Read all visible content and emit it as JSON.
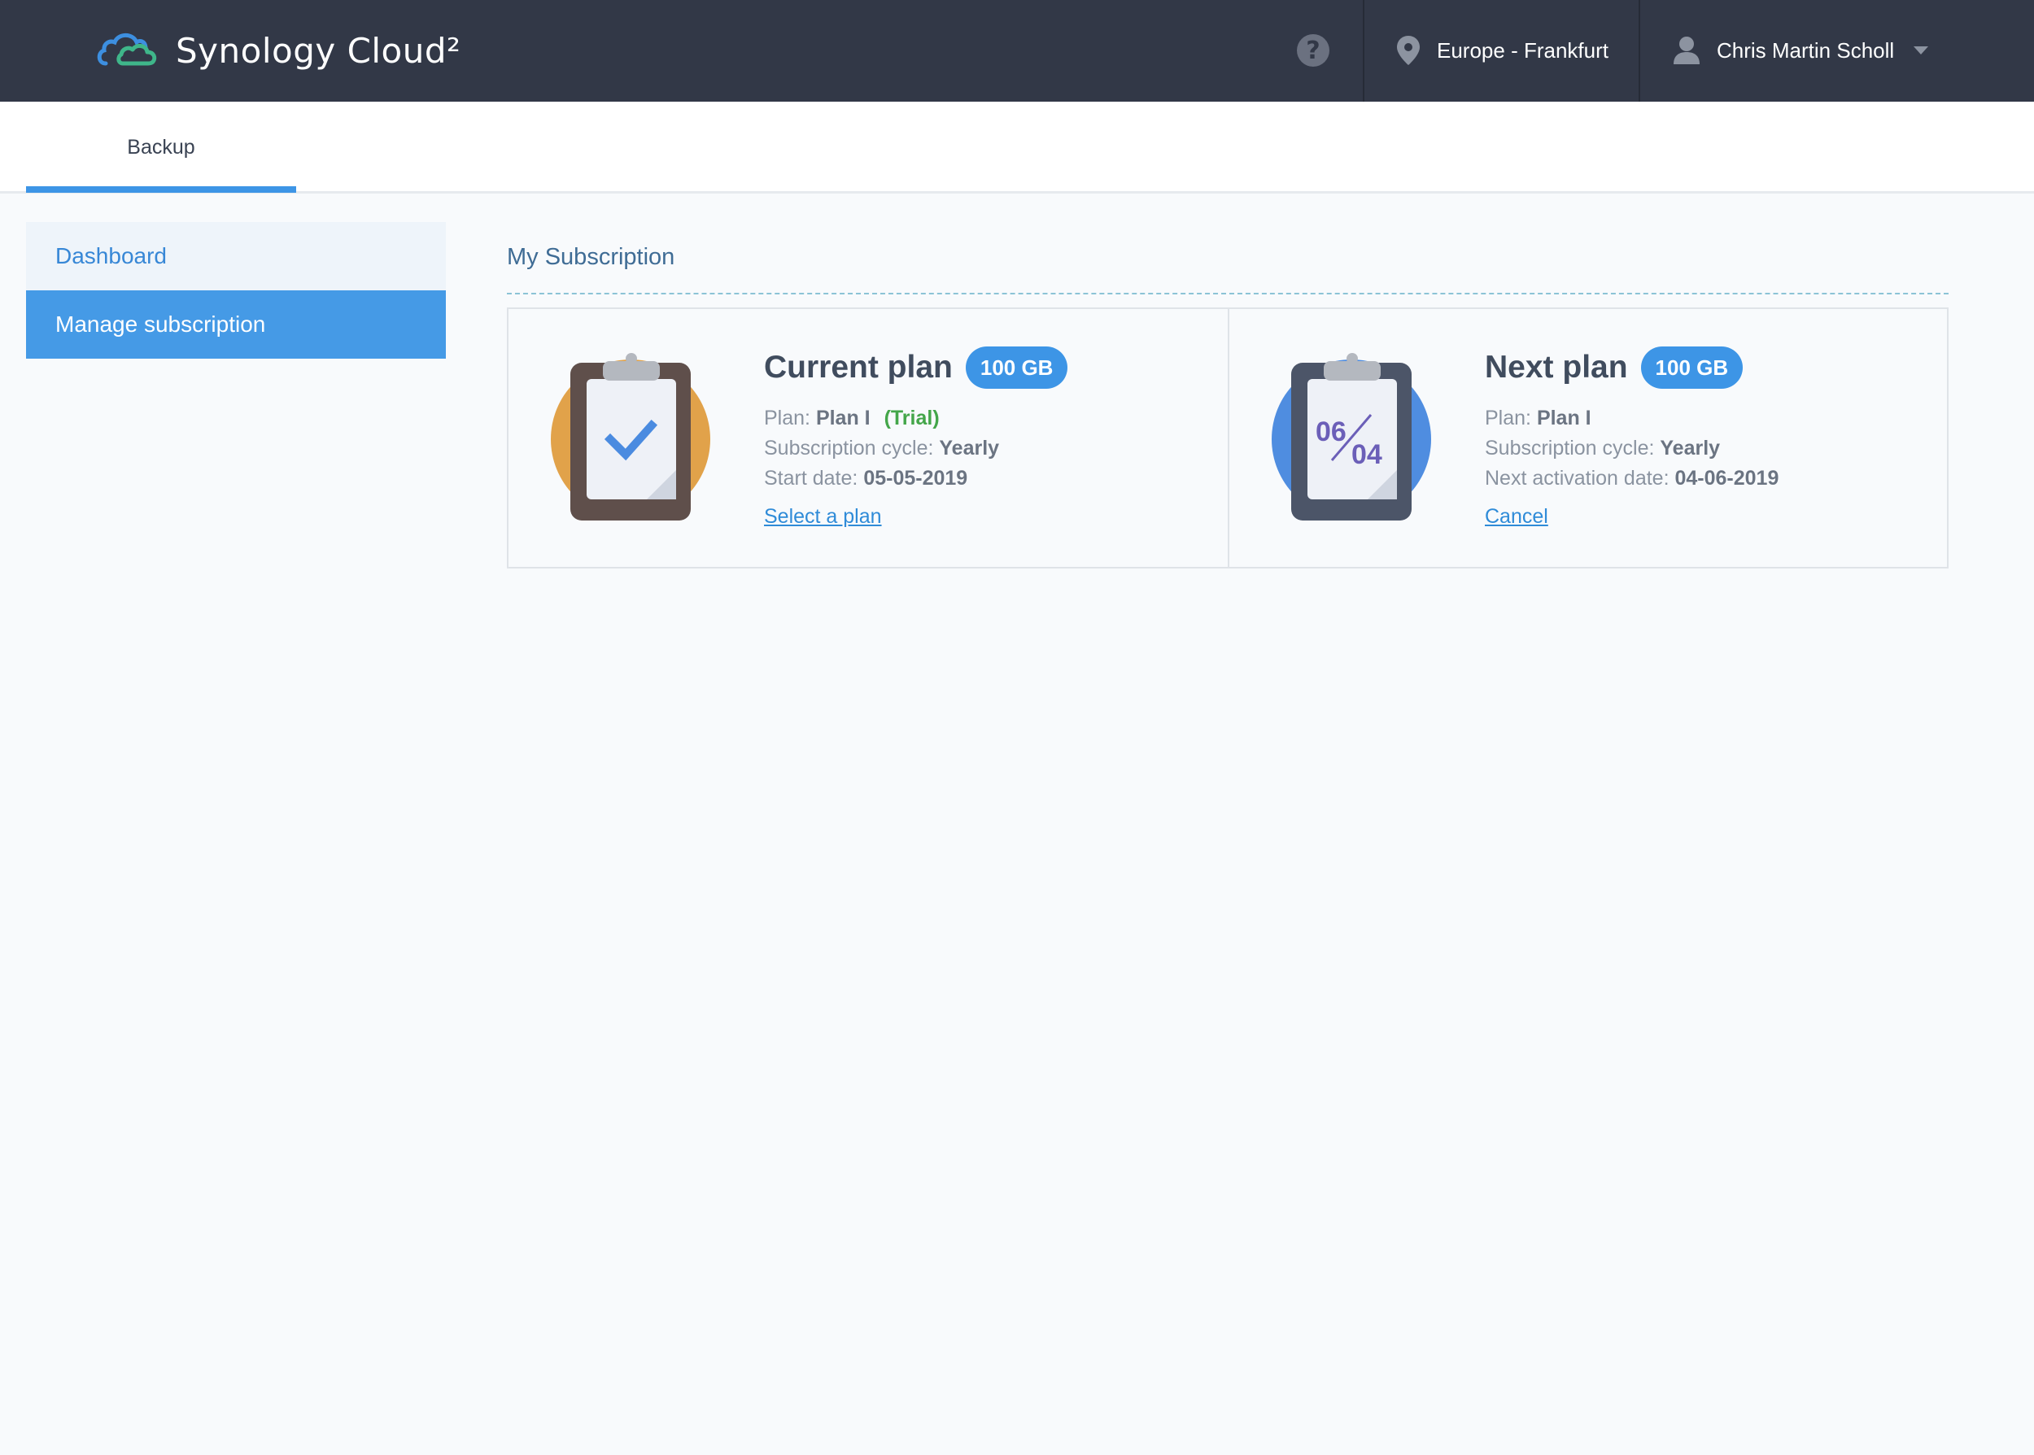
{
  "header": {
    "brand": "Synology Cloud²",
    "help_icon": "question-circle-icon",
    "region": "Europe - Frankfurt",
    "user": "Chris Martin Scholl",
    "colors": {
      "bar": "#323847",
      "accent": "#3d95e6"
    }
  },
  "tabs": [
    {
      "label": "Backup",
      "active": true
    }
  ],
  "sidebar": {
    "items": [
      {
        "label": "Dashboard",
        "active": false
      },
      {
        "label": "Manage subscription",
        "active": true
      }
    ]
  },
  "main": {
    "title": "My Subscription",
    "current_plan": {
      "title": "Current plan",
      "badge": "100 GB",
      "plan_label": "Plan:",
      "plan_value": "Plan I",
      "plan_status": "(Trial)",
      "cycle_label": "Subscription cycle:",
      "cycle_value": "Yearly",
      "date_label": "Start date:",
      "date_value": "05-05-2019",
      "link": "Select a plan",
      "icon": "clipboard-check-icon",
      "icon_color": "#e1a24a"
    },
    "next_plan": {
      "title": "Next plan",
      "badge": "100 GB",
      "plan_label": "Plan:",
      "plan_value": "Plan I",
      "cycle_label": "Subscription cycle:",
      "cycle_value": "Yearly",
      "date_label": "Next activation date:",
      "date_value": "04-06-2019",
      "link": "Cancel",
      "icon": "clipboard-date-icon",
      "icon_color": "#4f8de0",
      "icon_date_top": "06",
      "icon_date_bottom": "04"
    }
  }
}
